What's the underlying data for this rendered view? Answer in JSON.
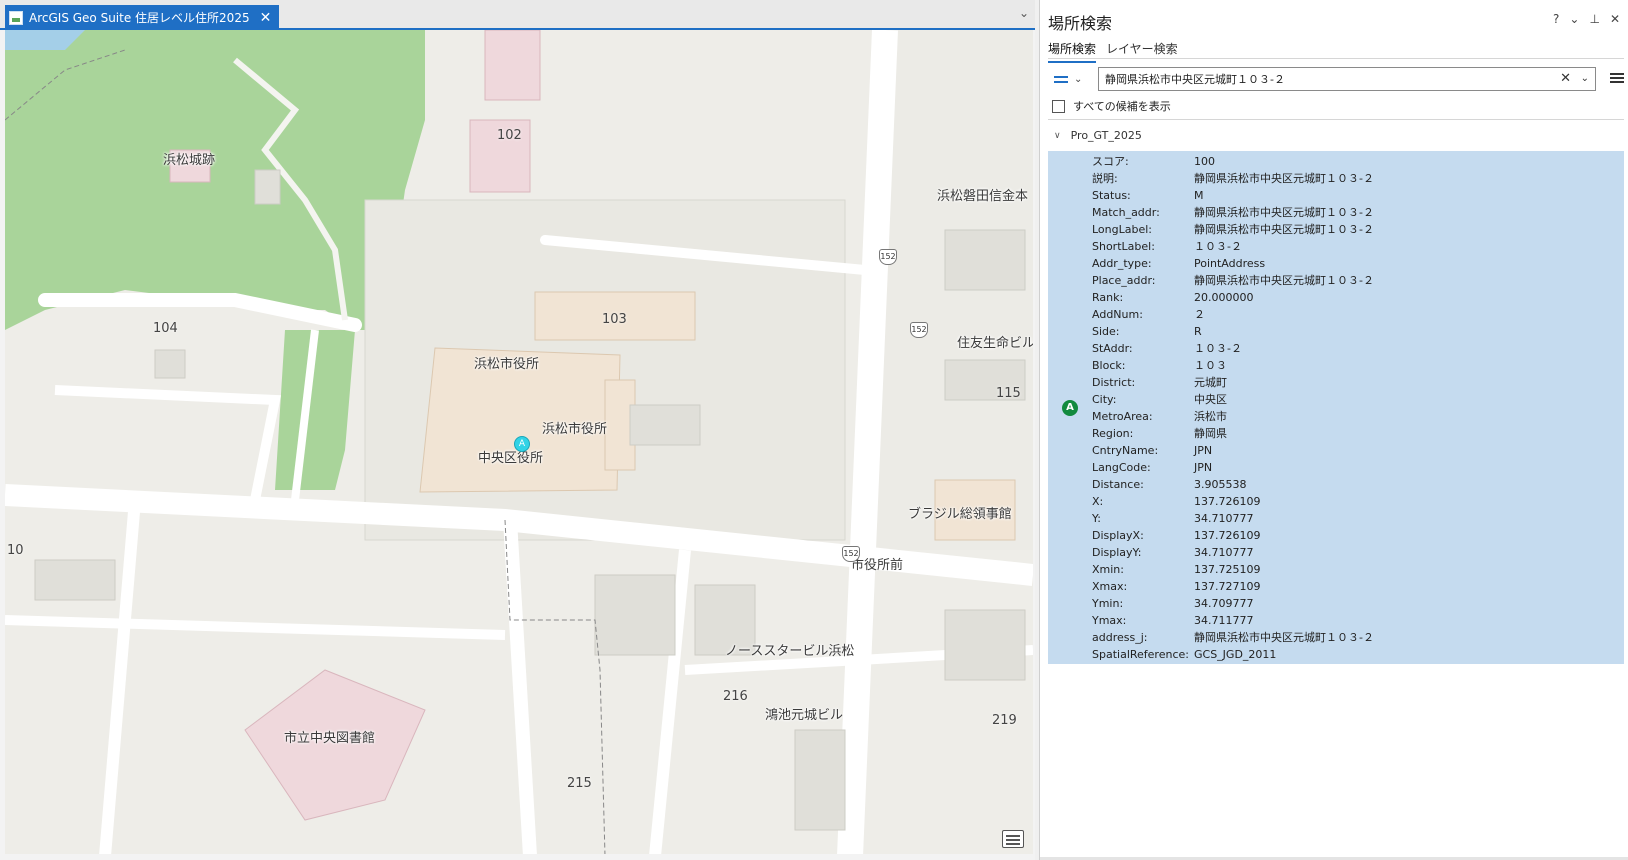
{
  "map_tab": {
    "title": "ArcGIS Geo Suite 住居レベル住所2025",
    "close": "✕"
  },
  "map": {
    "labels": {
      "hamamatsu_castle": "浜松城跡",
      "city_hall_1": "浜松市役所",
      "city_hall_2": "浜松市役所",
      "chuo_ward_office": "中央区役所",
      "shinkin_bank": "浜松磐田信金本",
      "sumitomo": "住友生命ビル",
      "brazil_consulate": "ブラジル総領事館",
      "shiyakusho_mae": "市役所前",
      "north_star": "ノーススタービル浜松",
      "konoike": "鴻池元城ビル",
      "library": "市立中央図書館"
    },
    "numbers": {
      "n102": "102",
      "n103": "103",
      "n104": "104",
      "n115": "115",
      "n10": "10",
      "n216": "216",
      "n215": "215",
      "n219": "219"
    },
    "route": "152",
    "marker": "A"
  },
  "pane": {
    "title": "場所検索",
    "controls": {
      "help": "?",
      "menu": "⌄",
      "pin": "⊥",
      "close": "✕"
    },
    "tabs": [
      "場所検索",
      "レイヤー検索"
    ],
    "search_value": "静岡県浜松市中央区元城町１０３-２",
    "show_all_label": "すべての候補を表示",
    "group_name": "Pro_GT_2025",
    "result_badge": "A",
    "attributes": [
      {
        "key": "スコア:",
        "value": "100"
      },
      {
        "key": "説明:",
        "value": "静岡県浜松市中央区元城町１０３-２"
      },
      {
        "key": "Status:",
        "value": "M"
      },
      {
        "key": "Match_addr:",
        "value": "静岡県浜松市中央区元城町１０３-２"
      },
      {
        "key": "LongLabel:",
        "value": "静岡県浜松市中央区元城町１０３-２"
      },
      {
        "key": "ShortLabel:",
        "value": "１０３-２"
      },
      {
        "key": "Addr_type:",
        "value": "PointAddress"
      },
      {
        "key": "Place_addr:",
        "value": "静岡県浜松市中央区元城町１０３-２"
      },
      {
        "key": "Rank:",
        "value": "20.000000"
      },
      {
        "key": "AddNum:",
        "value": "２"
      },
      {
        "key": "Side:",
        "value": "R"
      },
      {
        "key": "StAddr:",
        "value": "１０３-２"
      },
      {
        "key": "Block:",
        "value": "１０３"
      },
      {
        "key": "District:",
        "value": "元城町"
      },
      {
        "key": "City:",
        "value": "中央区"
      },
      {
        "key": "MetroArea:",
        "value": "浜松市"
      },
      {
        "key": "Region:",
        "value": "静岡県"
      },
      {
        "key": "CntryName:",
        "value": "JPN"
      },
      {
        "key": "LangCode:",
        "value": "JPN"
      },
      {
        "key": "Distance:",
        "value": "3.905538"
      },
      {
        "key": "X:",
        "value": "137.726109"
      },
      {
        "key": "Y:",
        "value": "34.710777"
      },
      {
        "key": "DisplayX:",
        "value": "137.726109"
      },
      {
        "key": "DisplayY:",
        "value": "34.710777"
      },
      {
        "key": "Xmin:",
        "value": "137.725109"
      },
      {
        "key": "Xmax:",
        "value": "137.727109"
      },
      {
        "key": "Ymin:",
        "value": "34.709777"
      },
      {
        "key": "Ymax:",
        "value": "34.711777"
      },
      {
        "key": "address_j:",
        "value": "静岡県浜松市中央区元城町１０３-２"
      },
      {
        "key": "SpatialReference:",
        "value": "GCS_JGD_2011"
      }
    ]
  }
}
